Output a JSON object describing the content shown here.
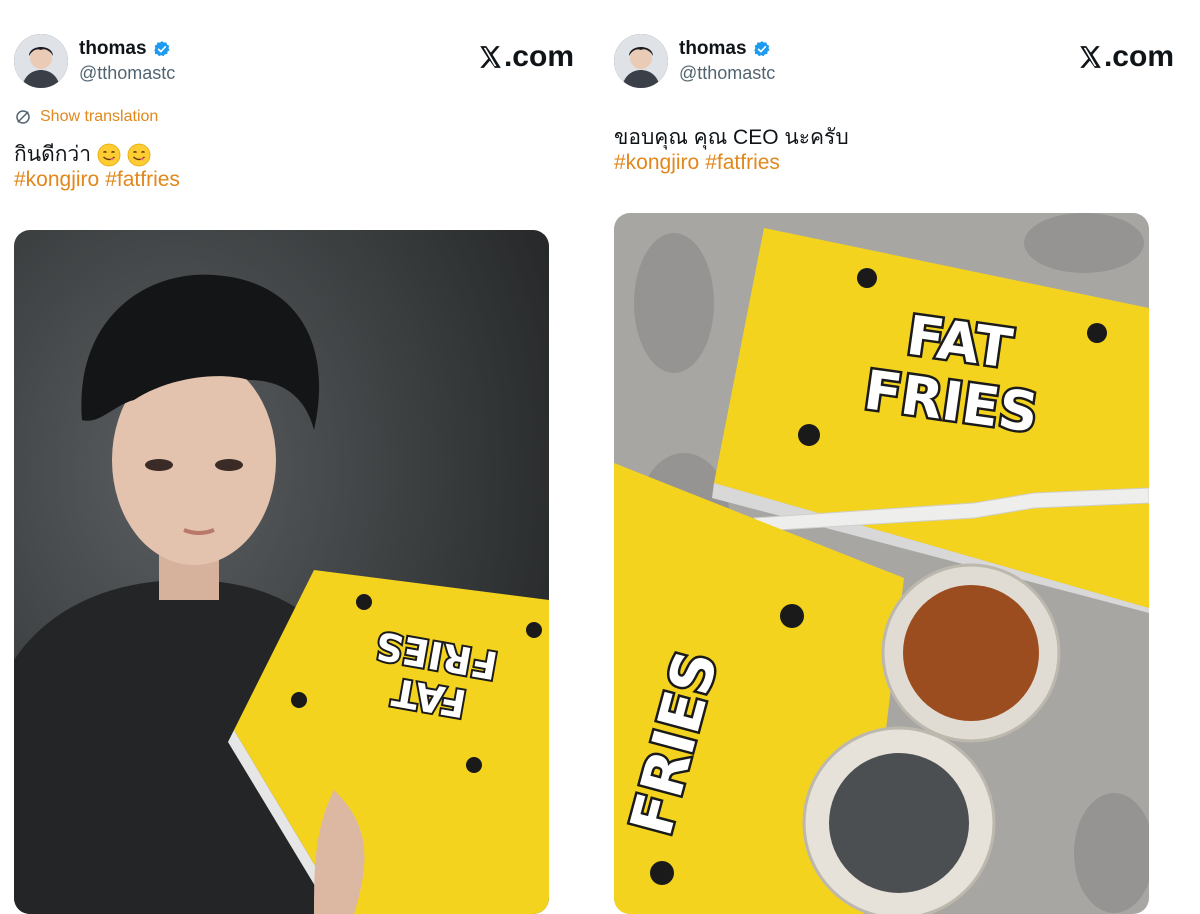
{
  "tweets": [
    {
      "author": {
        "name": "thomas",
        "handle": "@tthomastc"
      },
      "brand": ".com",
      "translation_label": "Show translation",
      "text": "กินดีกว่า",
      "hashtags": [
        "#kongjiro",
        "#fatfries"
      ],
      "emojis": [
        "face-savoring-food-emoji",
        "face-savoring-food-emoji"
      ],
      "photo": {
        "box_line1": "FAT",
        "box_line2": "FRIES"
      }
    },
    {
      "author": {
        "name": "thomas",
        "handle": "@tthomastc"
      },
      "brand": ".com",
      "text": "ขอบคุณ คุณ CEO นะครับ",
      "hashtags": [
        "#kongjiro",
        "#fatfries"
      ],
      "photo": {
        "box_line1": "FAT",
        "box_line2": "FRIES",
        "box2_text": "FRIES"
      }
    }
  ],
  "colors": {
    "accent": "#e2871b",
    "verified": "#1d9bf0",
    "box_yellow": "#f4d31f"
  }
}
